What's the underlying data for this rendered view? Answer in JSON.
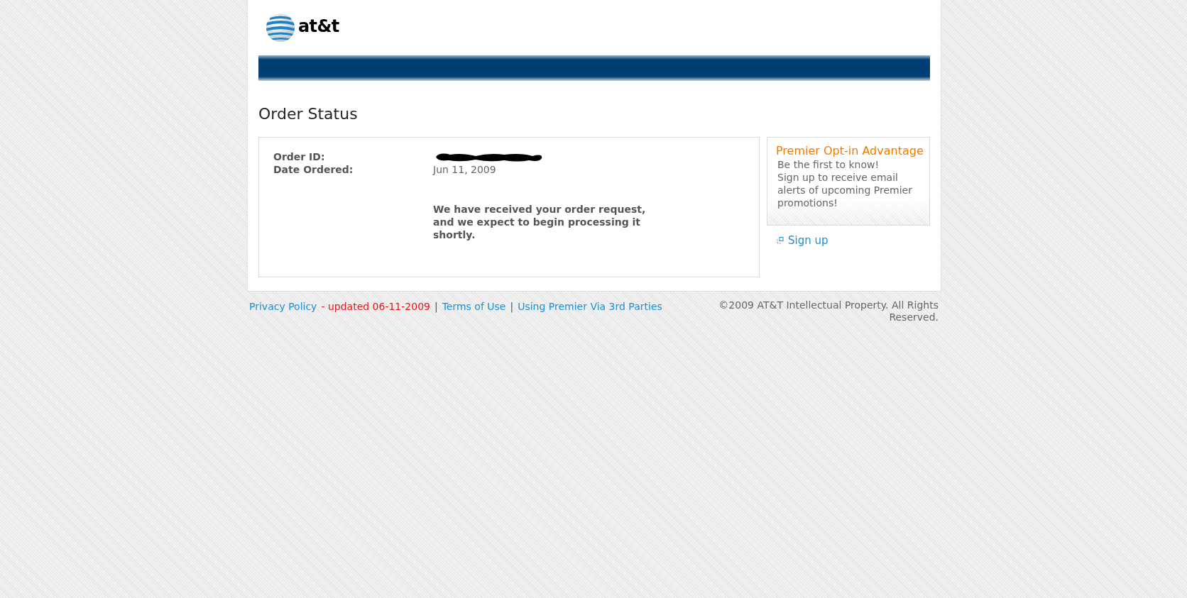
{
  "logo": {
    "text": "at&t"
  },
  "page_title": "Order Status",
  "order": {
    "fields": [
      {
        "label": "Order ID:",
        "kind": "redacted"
      },
      {
        "label": "Date Ordered:",
        "kind": "text",
        "value": "Jun 11, 2009"
      }
    ],
    "message": "We have received your order request, and we expect to begin processing it shortly."
  },
  "promo": {
    "title": "Premier Opt-in Advantage",
    "lines": [
      "Be the first to know!",
      "Sign up to receive email alerts of upcoming Premier promotions!"
    ],
    "link": "Sign up"
  },
  "footer": {
    "items": [
      {
        "kind": "link",
        "text": "Privacy Policy"
      },
      {
        "kind": "note",
        "text": "- updated 06-11-2009"
      },
      {
        "kind": "separator",
        "text": "|"
      },
      {
        "kind": "link",
        "text": "Terms of Use"
      },
      {
        "kind": "separator",
        "text": "|"
      },
      {
        "kind": "link",
        "text": "Using Premier Via 3rd Parties"
      }
    ],
    "copyright": "©2009 AT&T Intellectual Property. All Rights Reserved."
  }
}
